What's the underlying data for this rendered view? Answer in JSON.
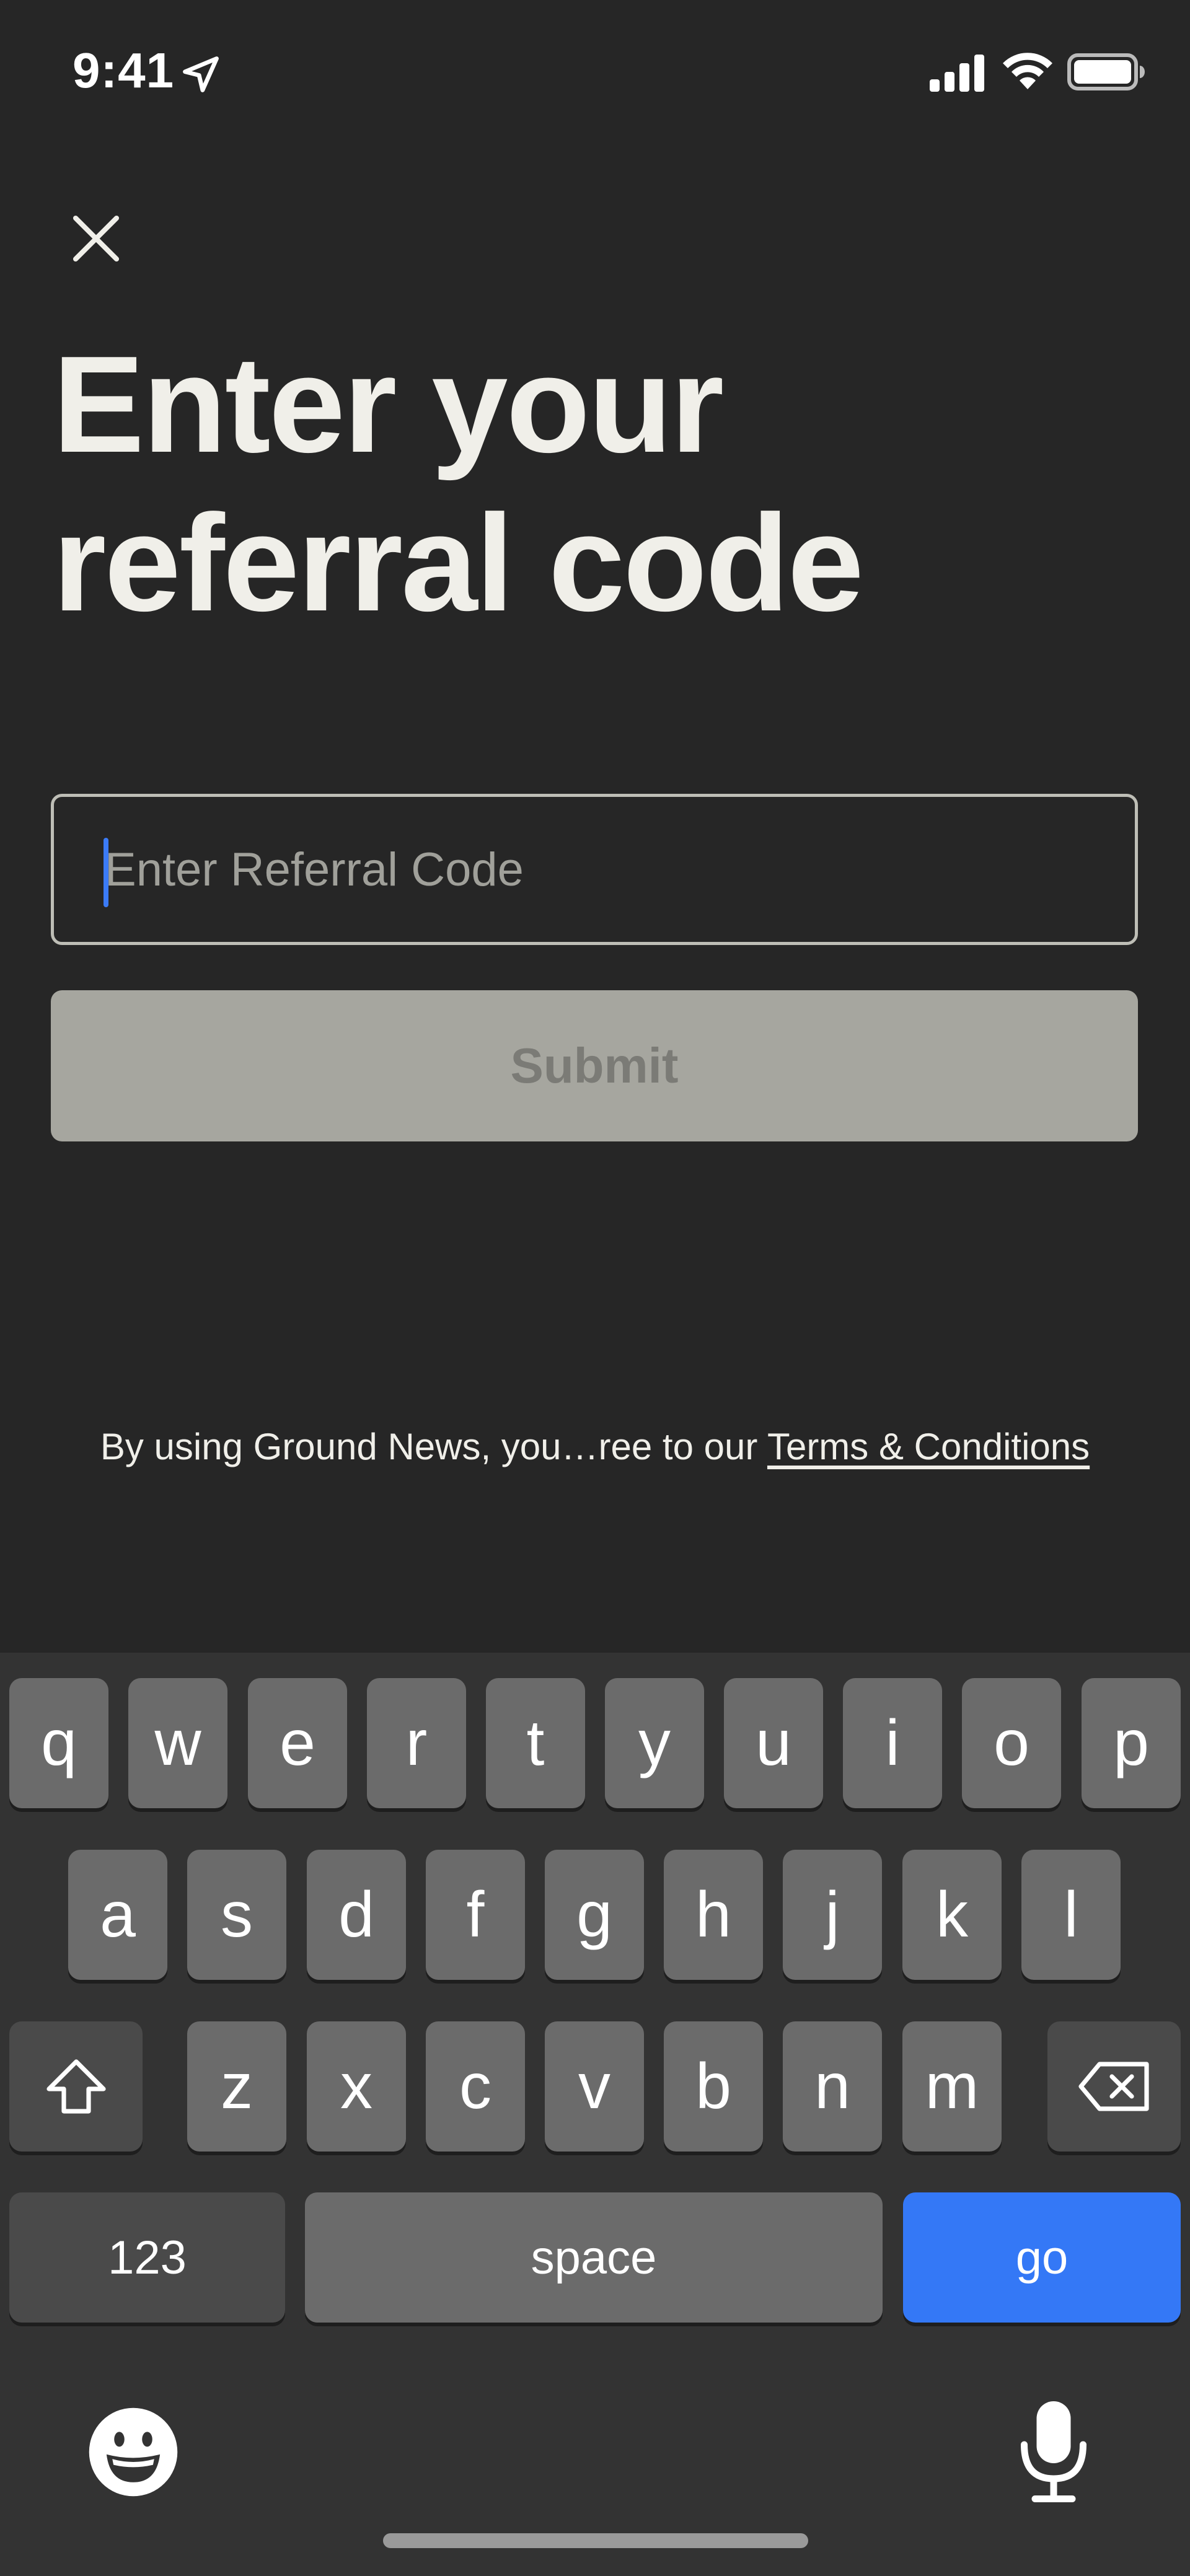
{
  "status_bar": {
    "time": "9:41",
    "icons": [
      "location-arrow-icon",
      "cellular-signal-icon",
      "wifi-icon",
      "battery-icon"
    ]
  },
  "header": {
    "close_icon": "close-icon",
    "title_line1": "Enter your",
    "title_line2": "referral code"
  },
  "form": {
    "input_value": "",
    "input_placeholder": "Enter Referral Code",
    "submit_label": "Submit"
  },
  "footer": {
    "terms_prefix": "By using Ground News, you…ree to our ",
    "terms_link": "Terms & Conditions"
  },
  "keyboard": {
    "row1": [
      "q",
      "w",
      "e",
      "r",
      "t",
      "y",
      "u",
      "i",
      "o",
      "p"
    ],
    "row2": [
      "a",
      "s",
      "d",
      "f",
      "g",
      "h",
      "j",
      "k",
      "l"
    ],
    "row3": [
      "z",
      "x",
      "c",
      "v",
      "b",
      "n",
      "m"
    ],
    "shift_icon": "shift-icon",
    "delete_icon": "delete-icon",
    "numbers_label": "123",
    "space_label": "space",
    "go_label": "go",
    "emoji_icon": "emoji-icon",
    "mic_icon": "microphone-icon"
  },
  "colors": {
    "background": "#262626",
    "title_text": "#f0efe9",
    "input_border": "#bebeb6",
    "submit_disabled_bg": "#a6a69f",
    "submit_disabled_text": "#7b7b76",
    "caret": "#3b7bf7",
    "keyboard_bg": "#333333",
    "key_bg": "#6b6b6b",
    "key_dark_bg": "#4a4a4a",
    "go_key_bg": "#3478f6"
  }
}
